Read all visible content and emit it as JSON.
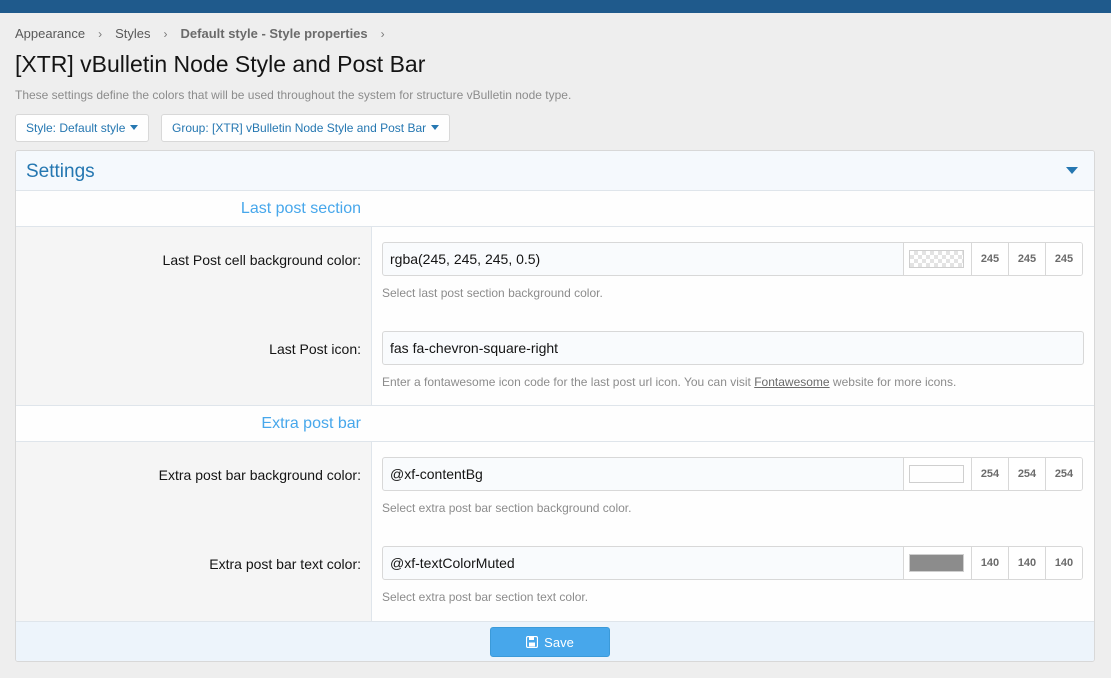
{
  "breadcrumb": {
    "items": [
      "Appearance",
      "Styles",
      "Default style - Style properties"
    ],
    "separator": "›"
  },
  "page": {
    "title": "[XTR] vBulletin Node Style and Post Bar",
    "description": "These settings define the colors that will be used throughout the system for structure vBulletin node type."
  },
  "filters": {
    "style_label": "Style: Default style",
    "group_label": "Group: [XTR] vBulletin Node Style and Post Bar"
  },
  "panel": {
    "title": "Settings",
    "collapse_icon": "chevron-down-icon"
  },
  "sections": [
    {
      "title": "Last post section",
      "rows": [
        {
          "label": "Last Post cell background color:",
          "value": "rgba(245, 245, 245, 0.5)",
          "swatch": "checkered",
          "rgb": [
            "245",
            "245",
            "245"
          ],
          "explain": "Select last post section background color."
        },
        {
          "label": "Last Post icon:",
          "value": "fas fa-chevron-square-right",
          "explain_before": "Enter a fontawesome icon code for the last post url icon. You can visit ",
          "explain_link": "Fontawesome",
          "explain_after": " website for more icons."
        }
      ]
    },
    {
      "title": "Extra post bar",
      "rows": [
        {
          "label": "Extra post bar background color:",
          "value": "@xf-contentBg",
          "swatch_color": "#fefefe",
          "rgb": [
            "254",
            "254",
            "254"
          ],
          "explain": "Select extra post bar section background color."
        },
        {
          "label": "Extra post bar text color:",
          "value": "@xf-textColorMuted",
          "swatch_color": "#8c8c8c",
          "rgb": [
            "140",
            "140",
            "140"
          ],
          "explain": "Select extra post bar section text color."
        }
      ]
    }
  ],
  "footer": {
    "save_label": "Save",
    "save_icon": "save-icon"
  },
  "colors": {
    "accent": "#2577b1",
    "header_bar": "#1f5a8c",
    "button": "#47a7eb"
  }
}
